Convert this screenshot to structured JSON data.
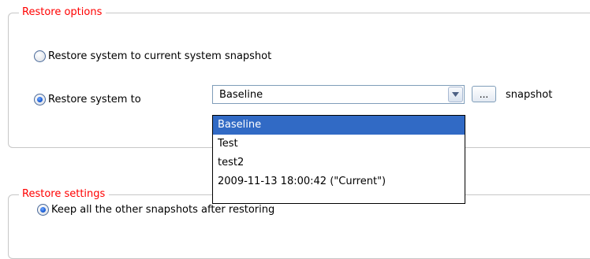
{
  "restore_options": {
    "legend": "Restore options",
    "option_current": "Restore system to current system snapshot",
    "option_to": "Restore system to",
    "combo_value": "Baseline",
    "browse_label": "...",
    "snapshot_label": "snapshot"
  },
  "dropdown": {
    "items": [
      "Baseline",
      "Test",
      "test2",
      "2009-11-13 18:00:42 (\"Current\")"
    ],
    "selected_index": 0
  },
  "restore_settings": {
    "legend": "Restore settings",
    "option_keep": "Keep all the other snapshots after restoring"
  },
  "colors": {
    "legend": "#ff0000",
    "selection": "#316ac5",
    "border": "#c7c7c7"
  }
}
